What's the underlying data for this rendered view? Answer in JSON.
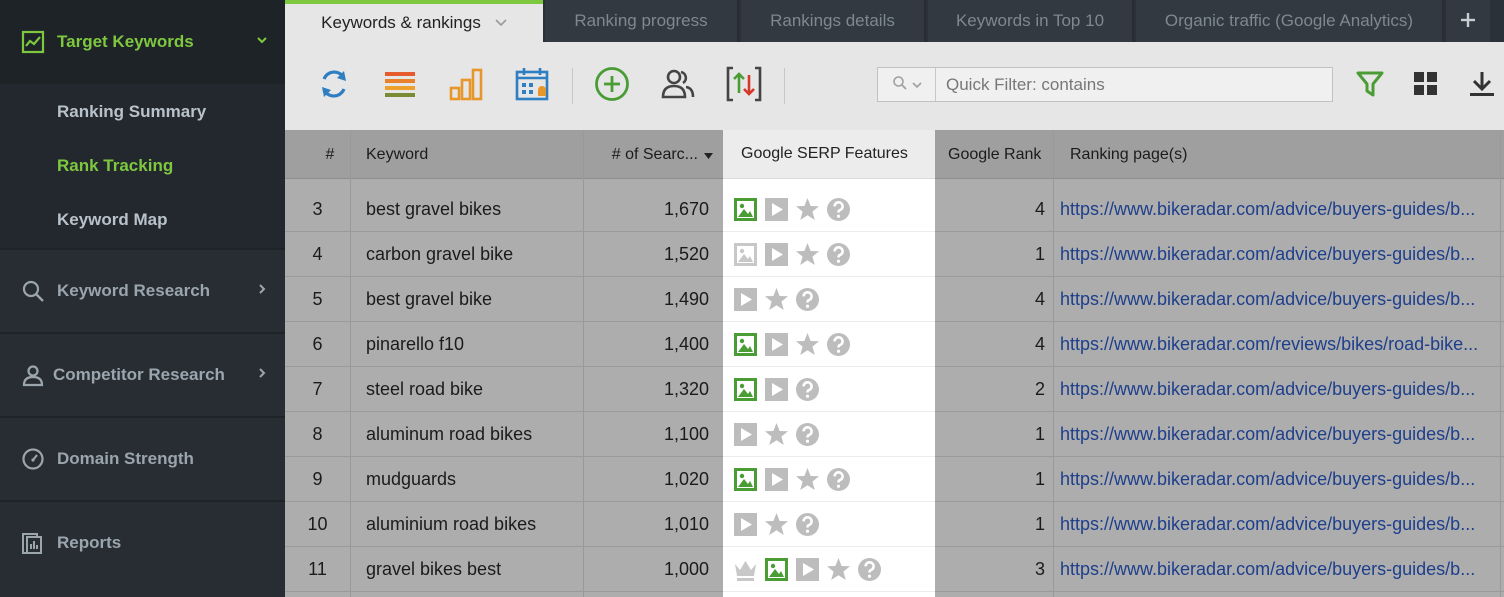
{
  "sidebar": {
    "section_target": "Target Keywords",
    "sub_items": [
      "Ranking Summary",
      "Rank Tracking",
      "Keyword Map"
    ],
    "active_sub": "Rank Tracking",
    "sections": [
      "Keyword Research",
      "Competitor Research",
      "Domain Strength",
      "Reports"
    ]
  },
  "tabs": [
    "Keywords & rankings",
    "Ranking progress",
    "Rankings details",
    "Keywords in Top 10",
    "Organic traffic (Google Analytics)"
  ],
  "active_tab": "Keywords & rankings",
  "toolbar": {
    "filter_placeholder": "Quick Filter: contains",
    "buttons": [
      "refresh-icon",
      "list-icon",
      "bar-chart-icon",
      "calendar-icon",
      "add-icon",
      "users-icon",
      "sort-icon",
      "filter-icon",
      "grid-view-icon",
      "download-icon"
    ]
  },
  "columns": {
    "num": "#",
    "keyword": "Keyword",
    "searches": "# of Searc...",
    "serp": "Google SERP Features",
    "rank": "Google Rank",
    "pages": "Ranking page(s)"
  },
  "rows": [
    {
      "num": "3",
      "keyword": "best gravel bikes",
      "searches": "1,670",
      "rank": "4",
      "url": "https://www.bikeradar.com/advice/buyers-guides/b...",
      "features": [
        "image-green",
        "video",
        "star",
        "question"
      ]
    },
    {
      "num": "4",
      "keyword": "carbon gravel bike",
      "searches": "1,520",
      "rank": "1",
      "url": "https://www.bikeradar.com/advice/buyers-guides/b...",
      "features": [
        "image-gray",
        "video",
        "star",
        "question"
      ]
    },
    {
      "num": "5",
      "keyword": "best gravel bike",
      "searches": "1,490",
      "rank": "4",
      "url": "https://www.bikeradar.com/advice/buyers-guides/b...",
      "features": [
        "video",
        "star",
        "question"
      ]
    },
    {
      "num": "6",
      "keyword": "pinarello f10",
      "searches": "1,400",
      "rank": "4",
      "url": "https://www.bikeradar.com/reviews/bikes/road-bike...",
      "features": [
        "image-green",
        "video",
        "star",
        "question"
      ]
    },
    {
      "num": "7",
      "keyword": "steel road bike",
      "searches": "1,320",
      "rank": "2",
      "url": "https://www.bikeradar.com/advice/buyers-guides/b...",
      "features": [
        "image-green",
        "video",
        "question"
      ]
    },
    {
      "num": "8",
      "keyword": "aluminum road bikes",
      "searches": "1,100",
      "rank": "1",
      "url": "https://www.bikeradar.com/advice/buyers-guides/b...",
      "features": [
        "video",
        "star",
        "question"
      ]
    },
    {
      "num": "9",
      "keyword": "mudguards",
      "searches": "1,020",
      "rank": "1",
      "url": "https://www.bikeradar.com/advice/buyers-guides/b...",
      "features": [
        "image-green",
        "video",
        "star",
        "question"
      ]
    },
    {
      "num": "10",
      "keyword": "aluminium road bikes",
      "searches": "1,010",
      "rank": "1",
      "url": "https://www.bikeradar.com/advice/buyers-guides/b...",
      "features": [
        "video",
        "star",
        "question"
      ]
    },
    {
      "num": "11",
      "keyword": "gravel bikes best",
      "searches": "1,000",
      "rank": "3",
      "url": "https://www.bikeradar.com/advice/buyers-guides/b...",
      "features": [
        "crown",
        "image-green",
        "video",
        "star",
        "question"
      ]
    }
  ],
  "colors": {
    "accent_green": "#7ec83f",
    "link_blue": "#1e3f8c",
    "icon_gray": "#bdbdbd",
    "sidebar_bg": "#272d33"
  }
}
